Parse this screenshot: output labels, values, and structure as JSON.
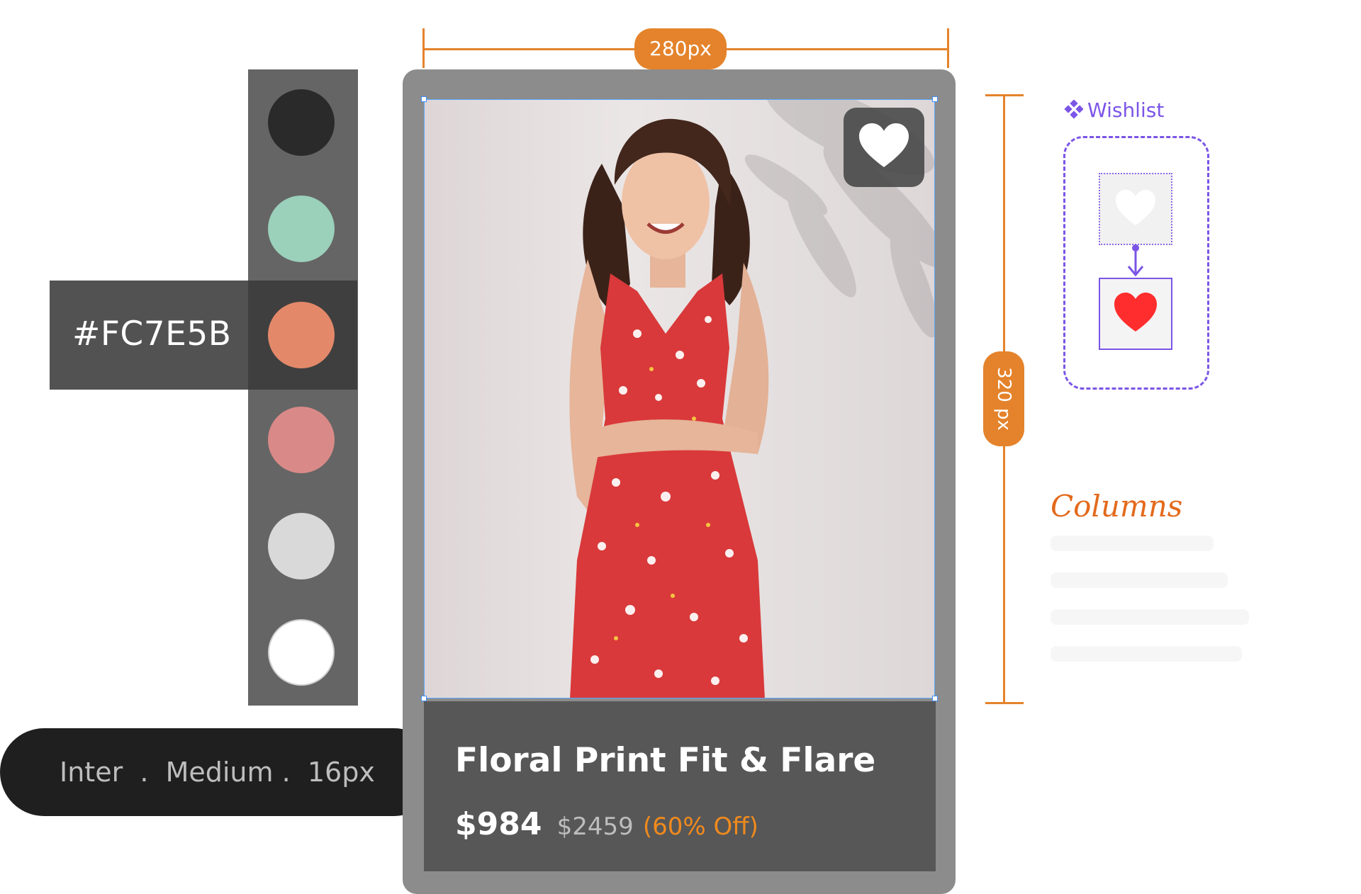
{
  "swatches": {
    "colors": [
      "#2a2a2a",
      "#9bd0bb",
      "#e3896a",
      "#d98a88",
      "#d9d9d9",
      "#ffffff"
    ],
    "selected_index": 2,
    "selected_hex_label": "#FC7E5B"
  },
  "typography": {
    "spec_label": "Inter  .  Medium .  16px"
  },
  "dimensions": {
    "width_label": "280px",
    "height_label": "320 px"
  },
  "product_card": {
    "image_alt": "Woman in red floral dress",
    "wishlist_icon": "heart-icon",
    "title": "Floral Print Fit & Flare",
    "price": "$984",
    "original_price": "$2459",
    "discount": "(60% Off)",
    "accent_color": "#f08a1d"
  },
  "wishlist_component": {
    "label": "Wishlist",
    "icon": "component-icon",
    "states": [
      "heart-outline-icon",
      "heart-filled-icon"
    ],
    "accent_color": "#7b55e6",
    "heart_color": "#ff2d2d"
  },
  "notes": {
    "columns_label": "Columns"
  }
}
